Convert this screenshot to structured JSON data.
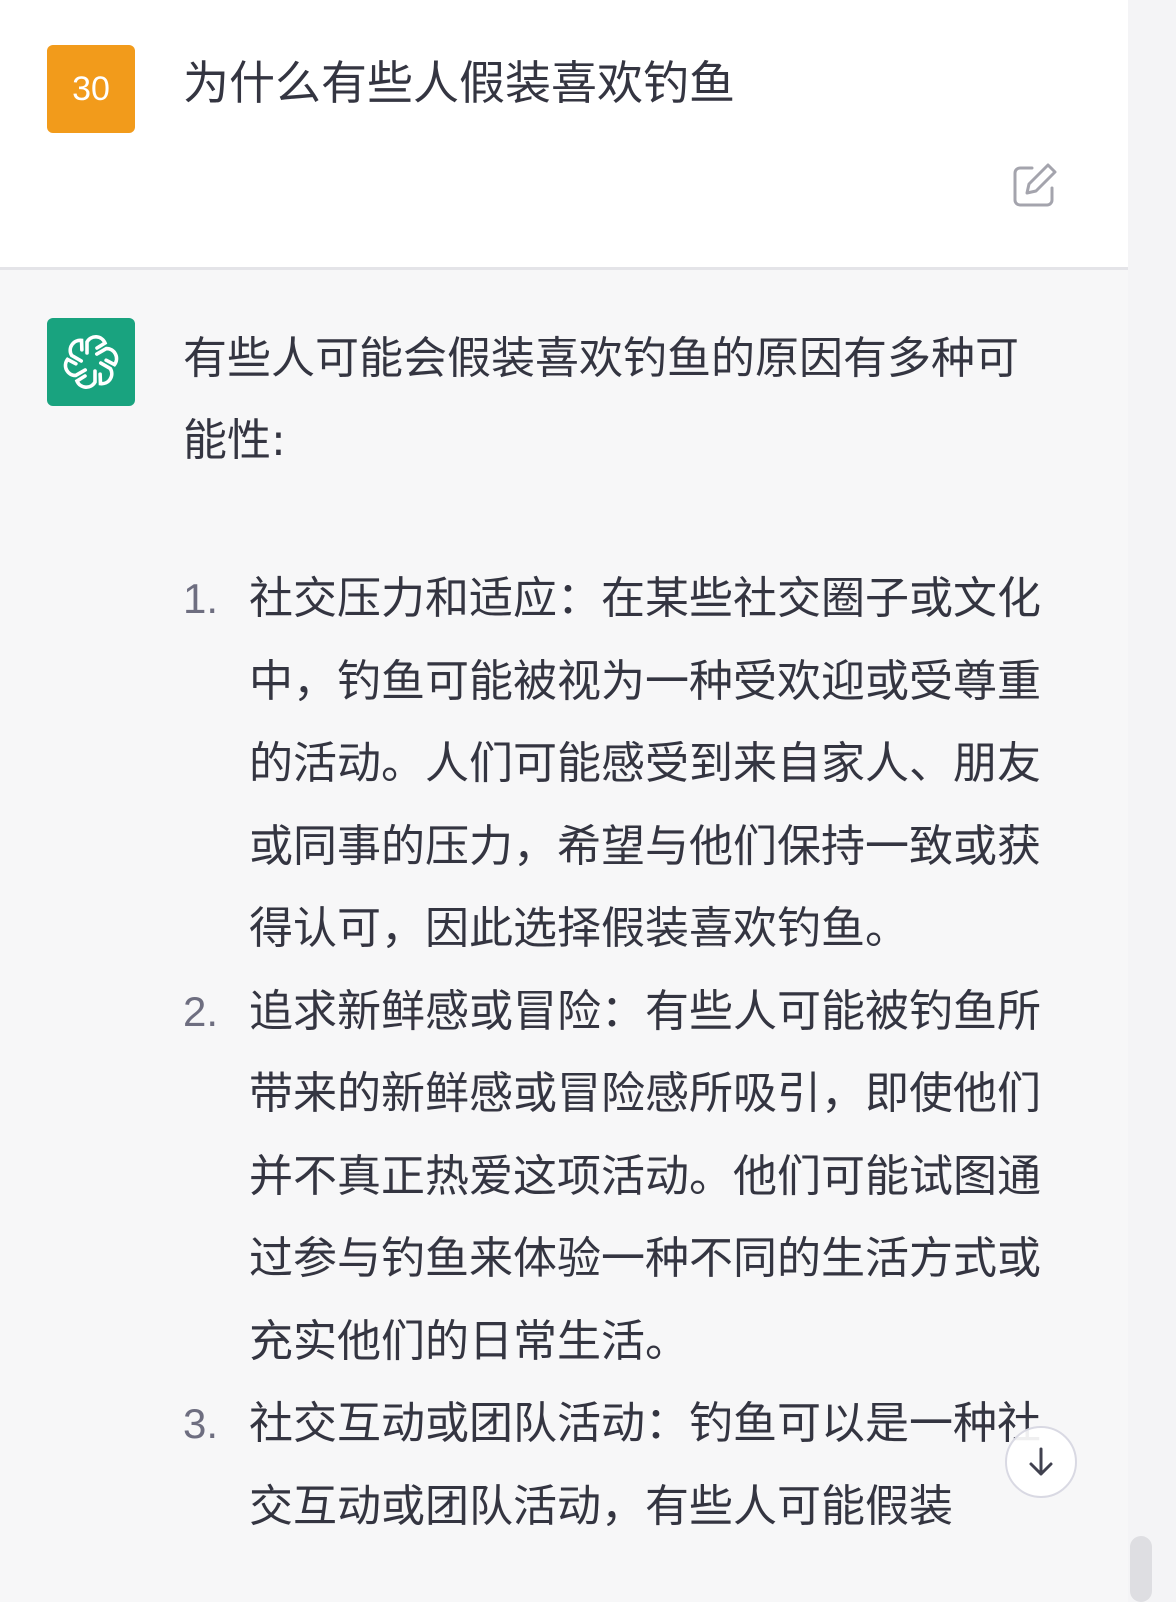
{
  "user_message": {
    "avatar_text": "30",
    "text": "为什么有些人假装喜欢钓鱼",
    "edit_icon": "edit-icon"
  },
  "assistant_message": {
    "avatar_icon": "openai-logo-icon",
    "intro": "有些人可能会假装喜欢钓鱼的原因有多种可能性:",
    "reasons": [
      {
        "number": "1.",
        "text": "社交压力和适应：在某些社交圈子或文化中，钓鱼可能被视为一种受欢迎或受尊重的活动。人们可能感受到来自家人、朋友或同事的压力，希望与他们保持一致或获得认可，因此选择假装喜欢钓鱼。"
      },
      {
        "number": "2.",
        "text": "追求新鲜感或冒险：有些人可能被钓鱼所带来的新鲜感或冒险感所吸引，即使他们并不真正热爱这项活动。他们可能试图通过参与钓鱼来体验一种不同的生活方式或充实他们的日常生活。"
      },
      {
        "number": "3.",
        "text": "社交互动或团队活动：钓鱼可以是一种社交互动或团队活动，有些人可能假装"
      }
    ]
  },
  "scroll_button_icon": "arrow-down-icon",
  "colors": {
    "user_avatar": "#f29b1b",
    "assistant_avatar": "#19a37f",
    "assistant_background": "#f7f7f8"
  }
}
